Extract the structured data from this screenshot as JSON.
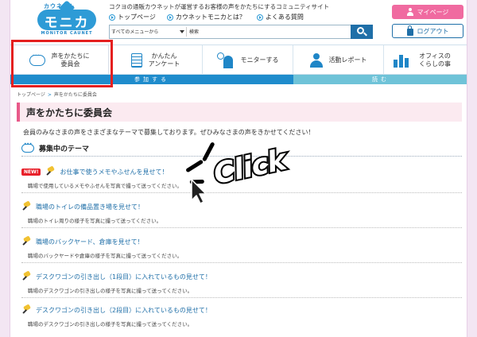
{
  "site": {
    "logo_top": "カウネット",
    "logo_main": "モニカ",
    "logo_sub": "MONITOR CAUNET",
    "tagline": "コクヨの通販カウネットが運営するお客様の声をかたちにするコミュニティサイト"
  },
  "toplinks": [
    "トップページ",
    "カウネットモニカとは？",
    "よくある質問"
  ],
  "search": {
    "category": "すべてのメニューから",
    "query": "検索"
  },
  "account": {
    "mypage": "マイページ",
    "login": "ログアウト"
  },
  "nav": {
    "items": [
      {
        "label_1": "声をかたちに",
        "label_2": "委員会",
        "icon": "chat-bubble-icon"
      },
      {
        "label_1": "かんたん",
        "label_2": "アンケート",
        "icon": "survey-list-icon"
      },
      {
        "label_1": "モニターする",
        "label_2": "",
        "icon": "monitor-person-icon"
      },
      {
        "label_1": "活動レポート",
        "label_2": "",
        "icon": "report-person-icon"
      },
      {
        "label_1": "オフィスの",
        "label_2": "くらしの事",
        "icon": "office-bars-icon"
      }
    ],
    "band_left": "参加する",
    "band_right": "読む"
  },
  "breadcrumb": {
    "home": "トップページ",
    "arrow": ">",
    "current": "声をかたちに委員会"
  },
  "page": {
    "title": "声をかたちに委員会",
    "intro": "会員のみなさまの声をさまざまなテーマで募集しております。ぜひみなさまの声をきかせてください！"
  },
  "section": {
    "heading": "募集中のテーマ"
  },
  "themes": [
    {
      "new": true,
      "badge": "NEW!",
      "title": "お仕事で使うメモやふせんを見せて！",
      "desc": "職場で使用しているメモやふせんを写真で撮って送ってください。"
    },
    {
      "new": false,
      "badge": "",
      "title": "職場のトイレの備品置き場を見せて！",
      "desc": "職場のトイレ周りの様子を写真に撮って送ってください。"
    },
    {
      "new": false,
      "badge": "",
      "title": "職場のバックヤード、倉庫を見せて！",
      "desc": "職場のバックヤードや倉庫の様子を写真に撮って送ってください。"
    },
    {
      "new": false,
      "badge": "",
      "title": "デスクワゴンの引き出し（1段目）に入れているもの見せて！",
      "desc": "職場のデスクワゴンの引き出しの様子を写真に撮って送ってください。"
    },
    {
      "new": false,
      "badge": "",
      "title": "デスクワゴンの引き出し（2段目）に入れているもの見せて！",
      "desc": "職場のデスクワゴンの引き出しの様子を写真に撮って送ってください。"
    }
  ],
  "annotation": {
    "click_text": "Click",
    "highlight_color": "#e41f1f"
  },
  "colors": {
    "accent": "#1f86c7",
    "pink": "#f06aa0",
    "title_border": "#e85a8a"
  }
}
